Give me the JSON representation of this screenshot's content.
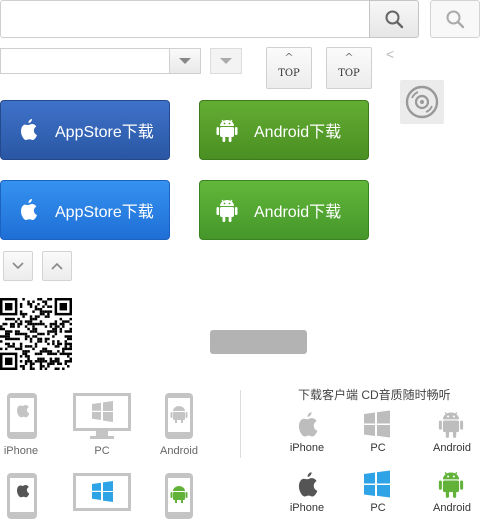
{
  "top_buttons": {
    "label": "TOP",
    "caret": "^"
  },
  "prev_arrow": "<",
  "download_buttons": {
    "appstore": "AppStore下载",
    "android": "Android下载"
  },
  "platforms": {
    "iphone": "iPhone",
    "pc": "PC",
    "android": "Android"
  },
  "right_panel": {
    "title": "下载客户端 CD音质随时畅听"
  },
  "colors": {
    "blue_dark": "#2f62b5",
    "blue_bright": "#2a80e6",
    "green_dark": "#55a02a",
    "green_bright": "#4fa82f",
    "icon_grey": "#bdbdbd",
    "apple_dark": "#555555",
    "windows_blue": "#2ea3e6",
    "android_green": "#62b23a"
  },
  "icons": [
    "search-icon",
    "chevron-down-icon",
    "chevron-up-icon",
    "disc-icon",
    "apple-icon",
    "android-icon",
    "windows-icon",
    "qr-code-icon",
    "phone-icon",
    "monitor-icon"
  ]
}
